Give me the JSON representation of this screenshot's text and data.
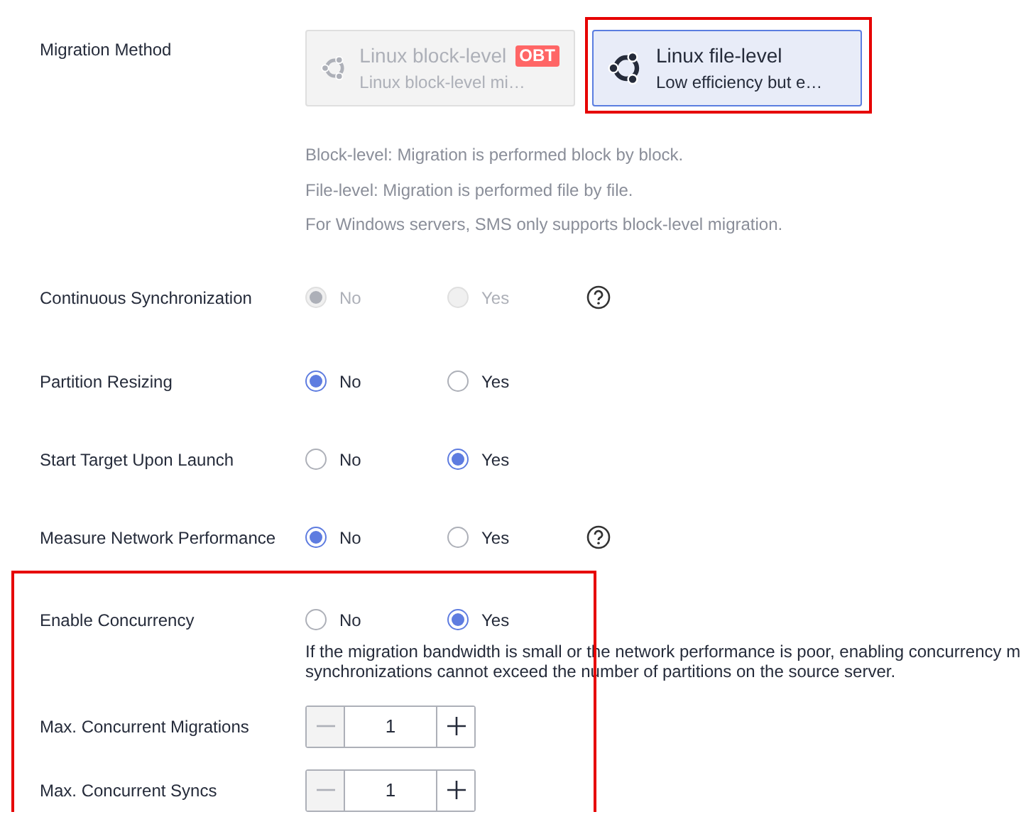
{
  "migration_method": {
    "label": "Migration Method",
    "options": [
      {
        "title": "Linux block-level",
        "badge": "OBT",
        "subtitle": "Linux block-level mi…",
        "selected": false,
        "disabled": true,
        "highlighted": false
      },
      {
        "title": "Linux file-level",
        "subtitle": "Low efficiency but e…",
        "selected": true,
        "disabled": false,
        "highlighted": true
      }
    ],
    "notes": [
      "Block-level: Migration is performed block by block.",
      "File-level: Migration is performed file by file.",
      "For Windows servers, SMS only supports block-level migration."
    ]
  },
  "settings": [
    {
      "kind": "radio",
      "label": "Continuous Synchronization",
      "disabled": true,
      "help": true,
      "options": [
        {
          "label": "No",
          "selected": true
        },
        {
          "label": "Yes",
          "selected": false
        }
      ]
    },
    {
      "kind": "radio",
      "label": "Partition Resizing",
      "disabled": false,
      "help": false,
      "options": [
        {
          "label": "No",
          "selected": true
        },
        {
          "label": "Yes",
          "selected": false
        }
      ]
    },
    {
      "kind": "radio",
      "label": "Start Target Upon Launch",
      "disabled": false,
      "help": false,
      "options": [
        {
          "label": "No",
          "selected": false
        },
        {
          "label": "Yes",
          "selected": true
        }
      ]
    },
    {
      "kind": "radio",
      "label": "Measure Network Performance",
      "disabled": false,
      "help": true,
      "options": [
        {
          "label": "No",
          "selected": true
        },
        {
          "label": "Yes",
          "selected": false
        }
      ]
    }
  ],
  "concurrency": {
    "highlighted": true,
    "items": [
      {
        "kind": "radio",
        "label": "Enable Concurrency",
        "disabled": false,
        "help": false,
        "options": [
          {
            "label": "No",
            "selected": false
          },
          {
            "label": "Yes",
            "selected": true
          }
        ],
        "description_lines": [
          "If the migration bandwidth is small or the network performance is poor, enabling concurrency m",
          "synchronizations cannot exceed the number of partitions on the source server."
        ]
      },
      {
        "kind": "stepper",
        "label": "Max. Concurrent Migrations",
        "value": "1"
      },
      {
        "kind": "stepper",
        "label": "Max. Concurrent Syncs",
        "value": "1"
      }
    ]
  }
}
